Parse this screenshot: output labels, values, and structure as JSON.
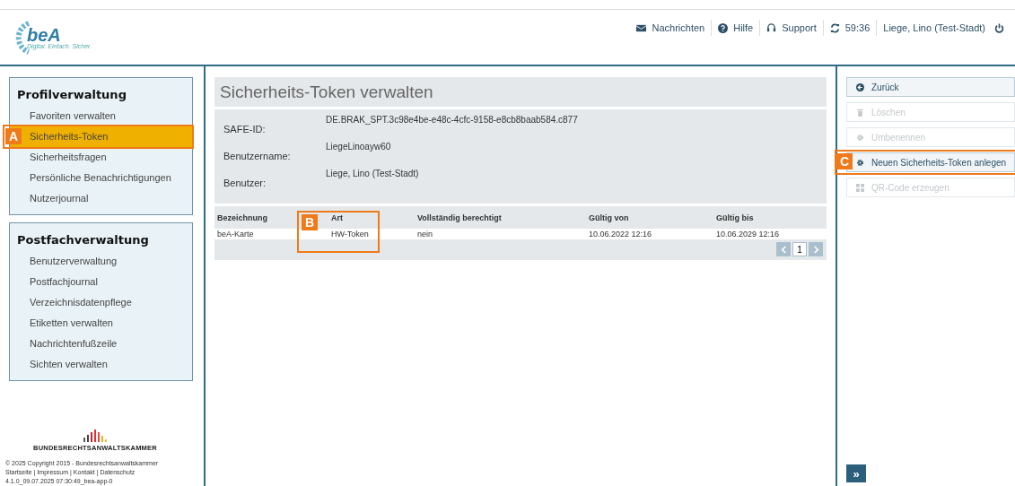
{
  "header": {
    "logo": {
      "name": "beA",
      "tagline": "Digital. Einfach. Sicher."
    },
    "nav": [
      {
        "kind": "mail",
        "label": "Nachrichten"
      },
      {
        "kind": "help",
        "label": "Hilfe"
      },
      {
        "kind": "support",
        "label": "Support"
      },
      {
        "kind": "refresh",
        "label": "59:36"
      },
      {
        "kind": "user",
        "label": "Liege, Lino (Test-Stadt)"
      }
    ]
  },
  "sidebar": {
    "sections": [
      {
        "title": "Profilverwaltung",
        "items": [
          {
            "label": "Favoriten verwalten",
            "selected": false
          },
          {
            "label": "Sicherheits-Token",
            "selected": true,
            "callout": "A"
          },
          {
            "label": "Sicherheitsfragen",
            "selected": false
          },
          {
            "label": "Persönliche Benachrichtigungen",
            "selected": false
          },
          {
            "label": "Nutzerjournal",
            "selected": false
          }
        ]
      },
      {
        "title": "Postfachverwaltung",
        "items": [
          {
            "label": "Benutzerverwaltung",
            "selected": false
          },
          {
            "label": "Postfachjournal",
            "selected": false
          },
          {
            "label": "Verzeichnisdatenpflege",
            "selected": false
          },
          {
            "label": "Etiketten verwalten",
            "selected": false
          },
          {
            "label": "Nachrichtenfußzeile",
            "selected": false
          },
          {
            "label": "Sichten verwalten",
            "selected": false
          }
        ]
      }
    ],
    "footer": {
      "org": "BUNDESRECHTSANWALTSKAMMER",
      "copyright": "© 2025 Copyright 2015 - Bundesrechtsanwaltskammer",
      "links": [
        "Startseite",
        "Impressum",
        "Kontakt",
        "Datenschutz"
      ],
      "separator": "|",
      "version": "4.1.0_09.07.2025 07:30:49_bea-app-0"
    }
  },
  "main": {
    "title": "Sicherheits-Token verwalten",
    "fields": [
      {
        "label": "SAFE-ID:",
        "value": "DE.BRAK_SPT.3c98e4be-e48c-4cfc-9158-e8cb8baab584.c877"
      },
      {
        "label": "Benutzername:",
        "value": "LiegeLinoayw60"
      },
      {
        "label": "Benutzer:",
        "value": "Liege, Lino (Test-Stadt)"
      }
    ],
    "table": {
      "columns": [
        {
          "label": "Bezeichnung"
        },
        {
          "label": "Art",
          "callout": "B"
        },
        {
          "label": "Vollständig berechtigt"
        },
        {
          "label": "Gültig von"
        },
        {
          "label": "Gültig bis"
        }
      ],
      "rows": [
        [
          "beA-Karte",
          "HW-Token",
          "nein",
          "10.06.2022 12:16",
          "10.06.2029 12:16"
        ]
      ]
    },
    "pagination": {
      "pages": [
        {
          "label": "1",
          "selected": true
        }
      ]
    }
  },
  "actions": [
    {
      "kind": "back",
      "label": "Zurück",
      "disabled": false
    },
    {
      "kind": "trash",
      "label": "Löschen",
      "disabled": true
    },
    {
      "kind": "gear",
      "label": "Umbenennen",
      "disabled": true
    },
    {
      "kind": "gear",
      "label": "Neuen Sicherheits-Token anlegen",
      "disabled": false,
      "callout": "C"
    },
    {
      "kind": "qr",
      "label": "QR-Code erzeugen",
      "disabled": true
    }
  ],
  "expand_button": "»"
}
